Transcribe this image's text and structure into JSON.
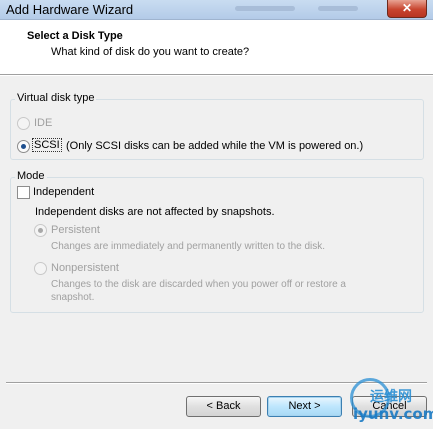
{
  "window": {
    "title": "Add Hardware Wizard",
    "close_glyph": "✕"
  },
  "header": {
    "title": "Select a Disk Type",
    "subtitle": "What kind of disk do you want to create?"
  },
  "virtual_disk_type": {
    "legend": "Virtual disk type",
    "ide_label": "IDE",
    "scsi_label": "SCSI",
    "scsi_note": "(Only SCSI disks can be added while the VM is powered on.)"
  },
  "mode": {
    "legend": "Mode",
    "independent_label": "Independent",
    "independent_desc": "Independent disks are not affected by snapshots.",
    "persistent_label": "Persistent",
    "persistent_desc": "Changes are immediately and permanently written to the disk.",
    "nonpersistent_label": "Nonpersistent",
    "nonpersistent_desc": "Changes to the disk are discarded when you power off or restore a snapshot."
  },
  "buttons": {
    "back": "< Back",
    "next": "Next >",
    "cancel": "Cancel"
  },
  "watermark": {
    "text": "运维网",
    "url": "iyunv.com"
  }
}
